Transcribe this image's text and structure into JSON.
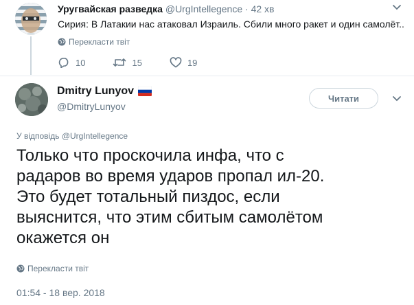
{
  "parent_tweet": {
    "name": "Уругвайская разведка",
    "handle": "@UrgIntellegence",
    "time": "· 42 хв",
    "text": "Сирия: В Латакии нас атаковал Израиль. Сбили много ракет и один самолёт..",
    "translate": "Перекласти твіт",
    "actions": {
      "replies": "10",
      "retweets": "15",
      "likes": "19"
    }
  },
  "main_tweet": {
    "name": "Dmitry Lunyov",
    "handle": "@DmitryLunyov",
    "follow_button": "Читати",
    "reply_prefix": "У відповідь",
    "reply_to": "@UrgIntellegence",
    "text": "Только что проскочила инфа, что с\nрадаров во время ударов пропал ил-20.\nЭто будет тотальный пиздос, если\nвыяснится, что этим сбитым самолётом\nокажется он",
    "translate": "Перекласти твіт",
    "timestamp": "01:54 - 18 вер. 2018"
  },
  "colors": {
    "text": "#14171a",
    "muted": "#657786",
    "border": "#e6ecf0",
    "button_border": "#ccd6dd"
  },
  "icons": [
    "globe-icon",
    "reply-icon",
    "retweet-icon",
    "heart-icon",
    "chevron-down-icon",
    "russia-flag-icon"
  ]
}
